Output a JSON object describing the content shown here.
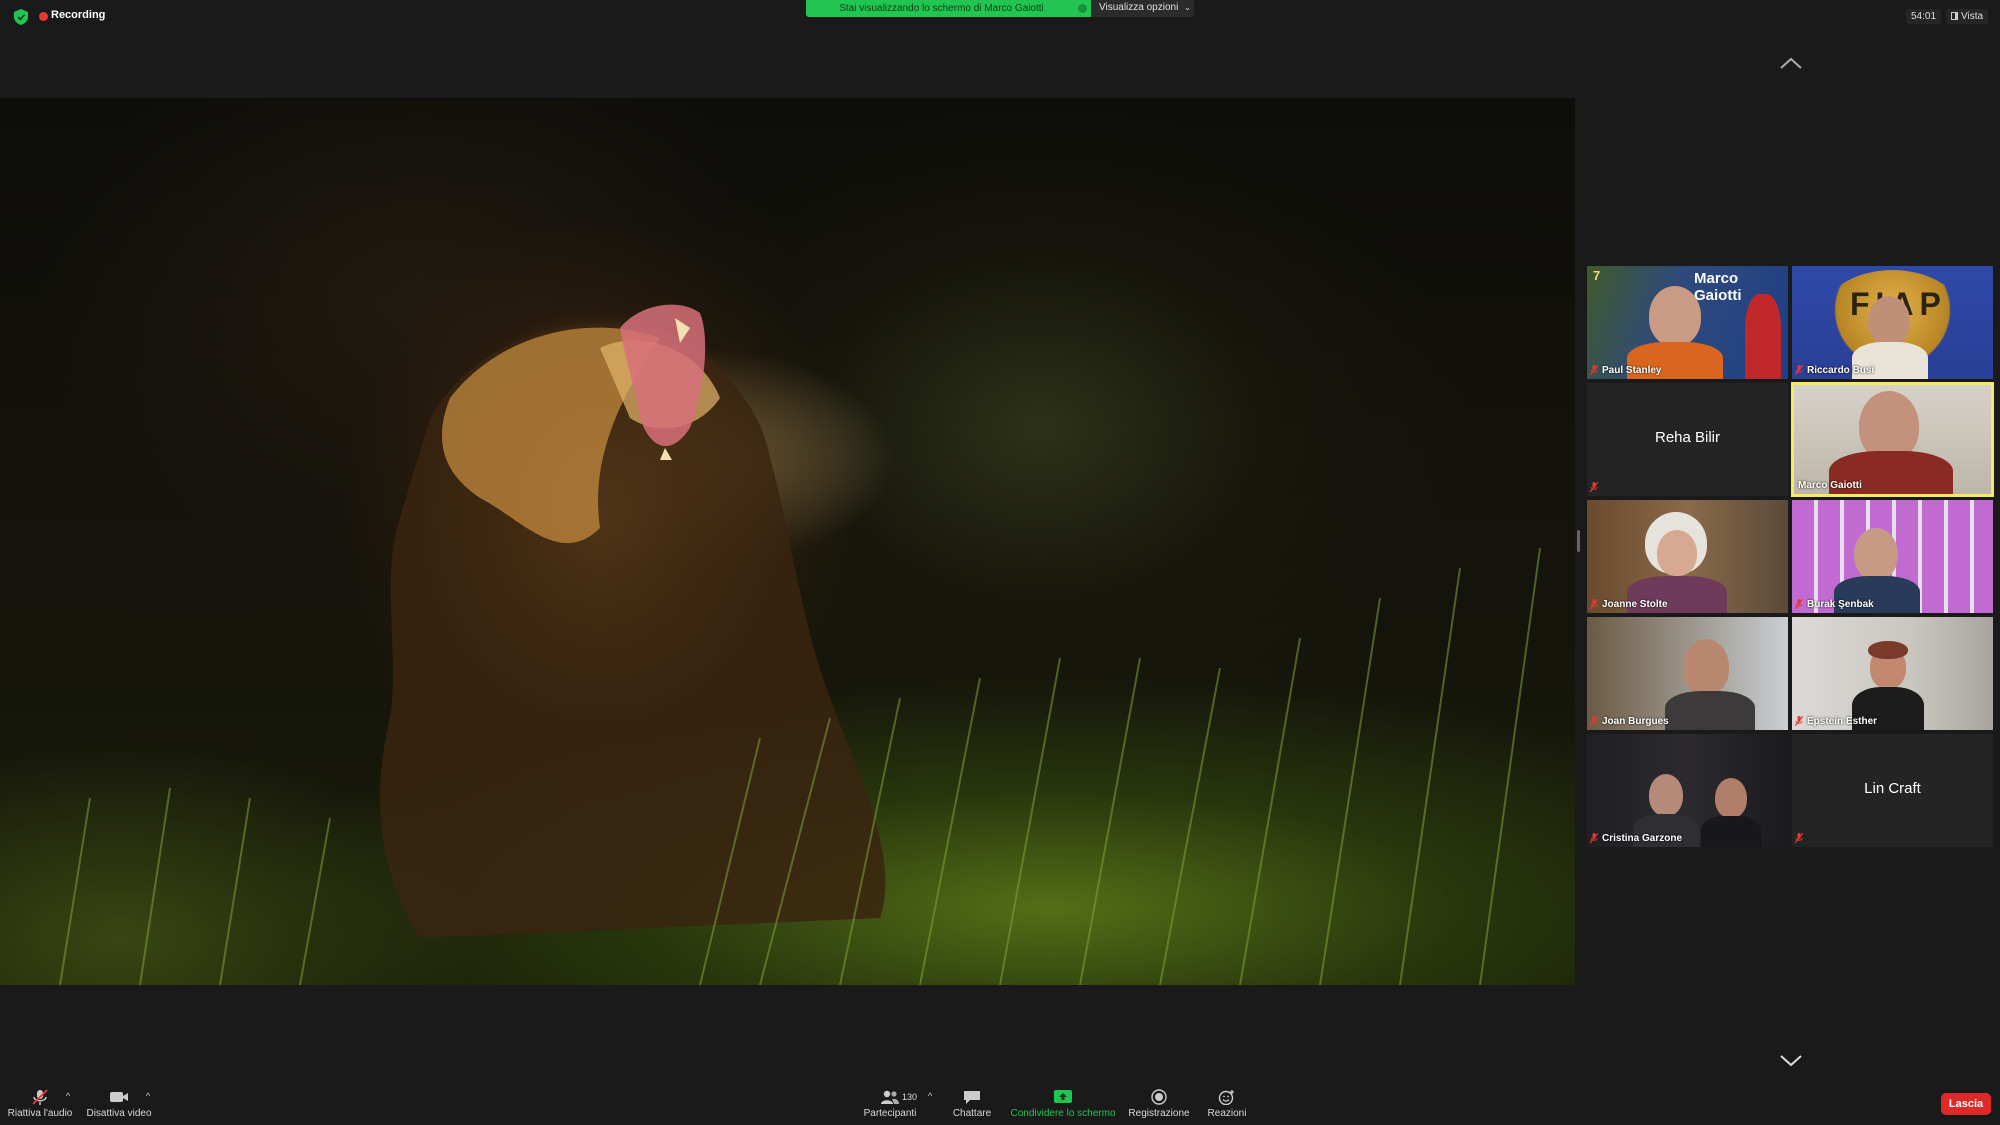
{
  "topbar": {
    "recording_label": "Recording",
    "share_banner": "Stai visualizzando lo schermo di Marco Gaiotti",
    "view_options": "Visualizza opzioni",
    "timer": "54:01",
    "vista_label": "Vista"
  },
  "participants": [
    {
      "name": "Paul Stanley",
      "muted": true,
      "video": true
    },
    {
      "name": "Riccardo Busi",
      "muted": true,
      "video": true
    },
    {
      "name": "Reha Bilir",
      "muted": true,
      "video": false
    },
    {
      "name": "Marco Gaiotti",
      "muted": false,
      "video": true,
      "speaking": true
    },
    {
      "name": "Joanne Stolte",
      "muted": true,
      "video": true
    },
    {
      "name": "Burak Şenbak",
      "muted": true,
      "video": true
    },
    {
      "name": "Joan Burgues",
      "muted": true,
      "video": true
    },
    {
      "name": "Epstein Esther",
      "muted": true,
      "video": true
    },
    {
      "name": "Cristina Garzone",
      "muted": true,
      "video": true
    },
    {
      "name": "Lin Craft",
      "muted": true,
      "video": false
    }
  ],
  "tile_overlays": {
    "paul_banner_title": "Marco Gaiotti",
    "paul_banner_number": "7",
    "riccardo_banner_text": "FIAP"
  },
  "toolbar": {
    "unmute": "Riattiva l'audio",
    "stop_video": "Disattiva video",
    "participants": "Partecipanti",
    "participants_count": "130",
    "chat": "Chattare",
    "share_screen": "Condividere lo schermo",
    "record": "Registrazione",
    "reactions": "Reazioni",
    "leave": "Lascia"
  },
  "colors": {
    "share_green": "#23c552",
    "leave_red": "#e02828",
    "speaker_border": "#f2ec64",
    "recording_dot": "#e53935"
  }
}
